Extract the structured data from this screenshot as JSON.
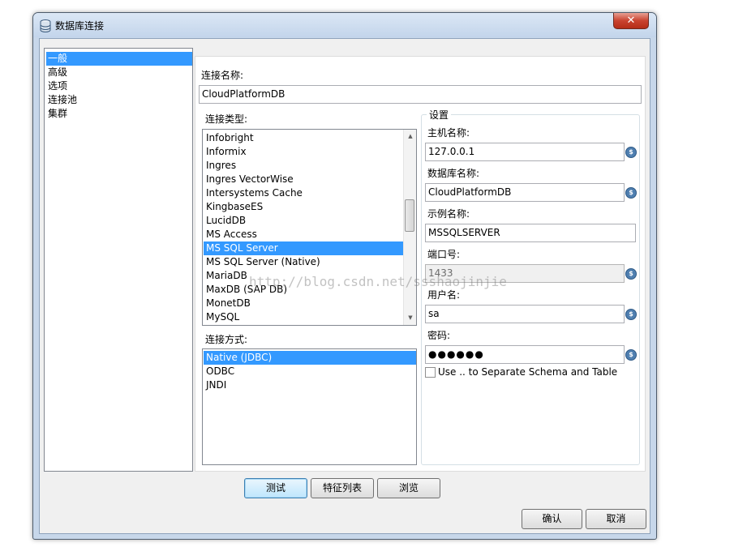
{
  "window": {
    "title": "数据库连接",
    "close_label": "✕"
  },
  "nav": {
    "items": [
      "一般",
      "高级",
      "选项",
      "连接池",
      "集群"
    ]
  },
  "general": {
    "conn_name_label": "连接名称:",
    "conn_name_value": "CloudPlatformDB",
    "conn_type_label": "连接类型:",
    "conn_types": [
      "Infobright",
      "Informix",
      "Ingres",
      "Ingres VectorWise",
      "Intersystems Cache",
      "KingbaseES",
      "LucidDB",
      "MS Access",
      "MS SQL Server",
      "MS SQL Server (Native)",
      "MariaDB",
      "MaxDB (SAP DB)",
      "MonetDB",
      "MySQL"
    ],
    "conn_type_selected": "MS SQL Server",
    "access_label": "连接方式:",
    "access_methods": [
      "Native (JDBC)",
      "ODBC",
      "JNDI"
    ],
    "access_selected": "Native (JDBC)"
  },
  "settings": {
    "legend": "设置",
    "host_label": "主机名称:",
    "host_value": "127.0.0.1",
    "db_label": "数据库名称:",
    "db_value": "CloudPlatformDB",
    "instance_label": "示例名称:",
    "instance_value": "MSSQLSERVER",
    "port_label": "端口号:",
    "port_value": "1433",
    "user_label": "用户名:",
    "user_value": "sa",
    "password_label": "密码:",
    "password_value": "●●●●●●",
    "schema_checkbox_label": "Use .. to Separate Schema and Table",
    "schema_checked": false
  },
  "buttons": {
    "test": "测试",
    "features": "特征列表",
    "browse": "浏览",
    "ok": "确认",
    "cancel": "取消"
  },
  "watermark": "http://blog.csdn.net/ssshaojinjie",
  "colors": {
    "selection": "#3399ff",
    "window_frame": "#c7d7ea",
    "close_button": "#c9432f"
  },
  "icons": {
    "app": "database-icon",
    "variable": "variable-dollar-icon",
    "scroll_up": "scroll-up-arrow-icon",
    "scroll_down": "scroll-down-arrow-icon"
  }
}
